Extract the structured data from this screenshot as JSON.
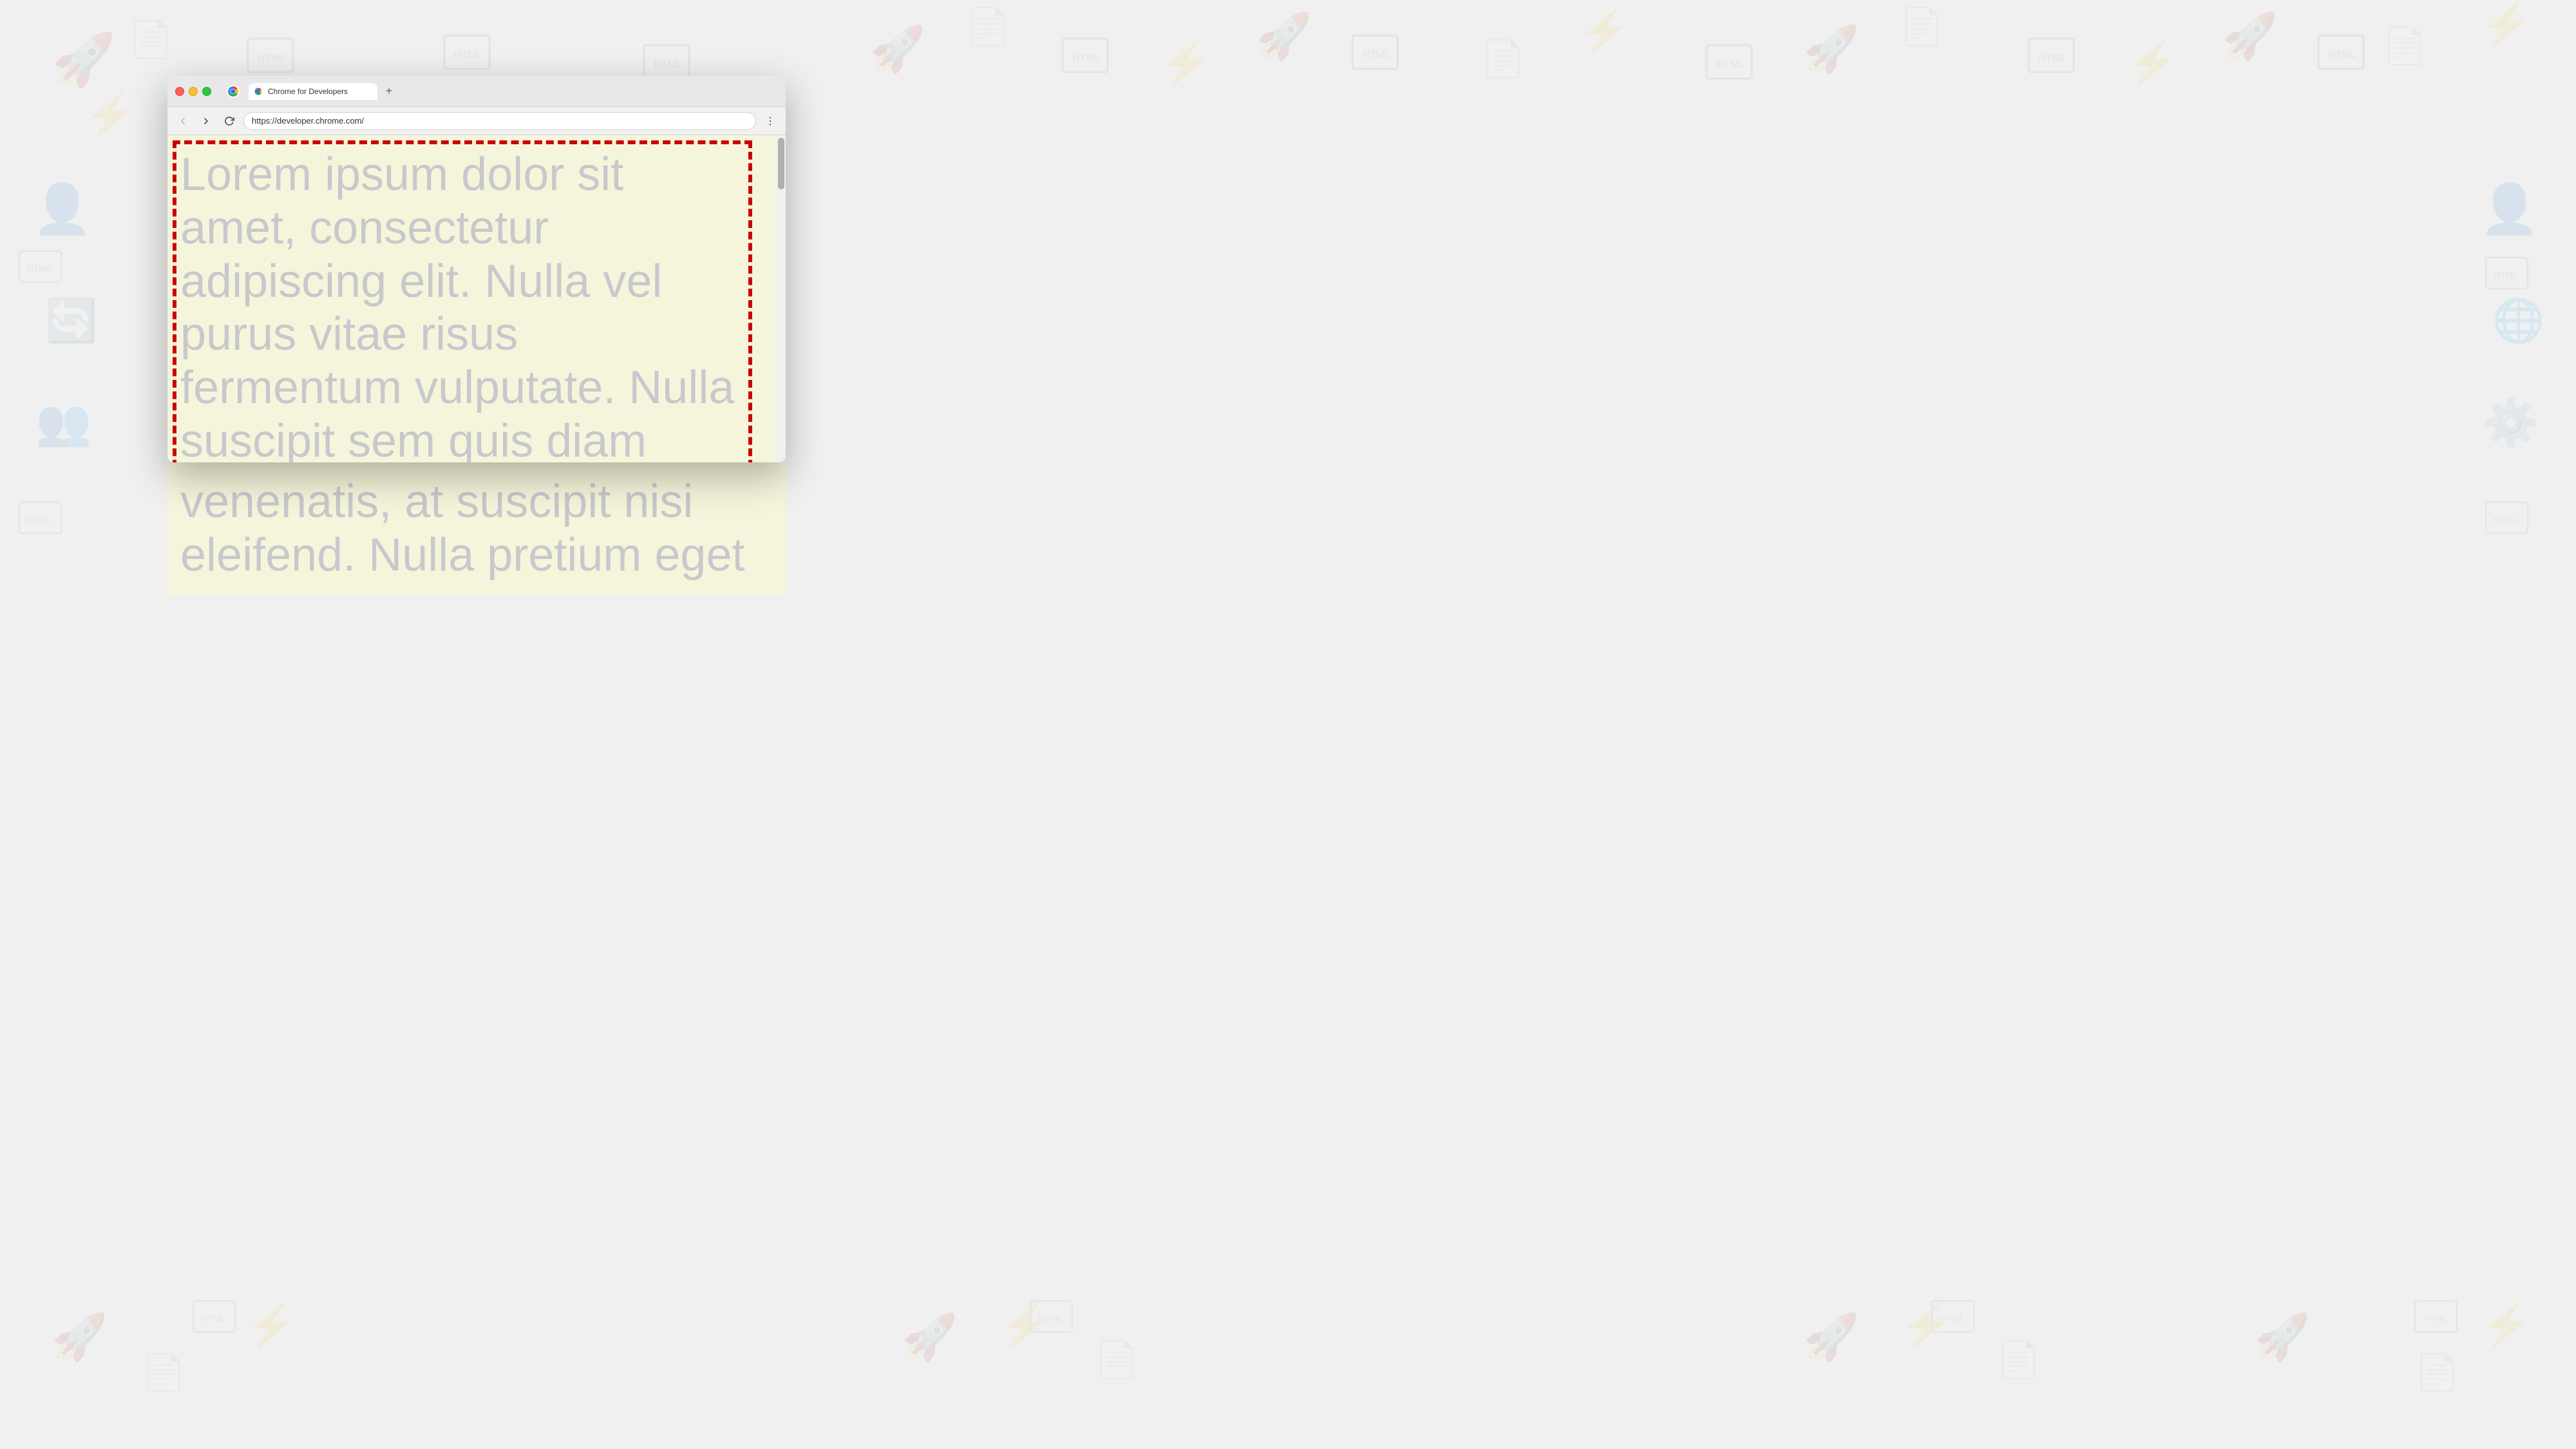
{
  "background": {
    "color": "#f0f0f0"
  },
  "browser": {
    "title_bar": {
      "tab_title": "Chrome for Developers",
      "new_tab_label": "+"
    },
    "nav_bar": {
      "url": "https://developer.chrome.com/",
      "back_label": "←",
      "forward_label": "→",
      "reload_label": "↺",
      "menu_label": "⋮"
    },
    "page": {
      "lorem_text": "Lorem ipsum dolor sit amet, consectetur adipiscing elit. Nulla vel purus vitae risus fermentum vulputate. Nulla suscipit sem quis diam venenatis, at suscipit nisi eleifend. Nulla pretium eget",
      "bg_color": "#f5f5dc",
      "text_color": "#c8c8cc",
      "border_color": "#cc0000"
    }
  }
}
